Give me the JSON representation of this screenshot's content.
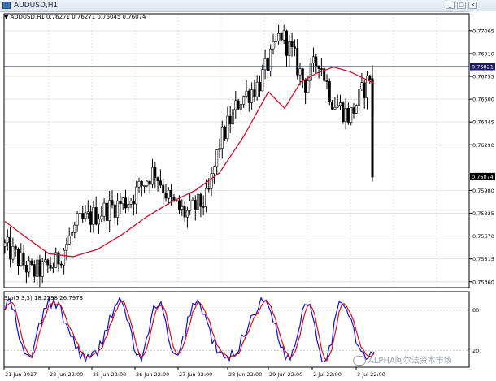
{
  "window": {
    "title": "AUDUSD,H1",
    "controls": {
      "minimize": "_",
      "restore": "□",
      "close": "×"
    }
  },
  "chart": {
    "info": "▼ AUDUSD,H1  0.76271  0.76271  0.76045  0.76074",
    "ylim": [
      0.7532,
      0.7718
    ],
    "price_labels": [
      "0.77065",
      "0.76910",
      "0.76755",
      "0.76600",
      "0.76445",
      "0.76290",
      "0.75980",
      "0.75825",
      "0.75670",
      "0.75515",
      "0.75360"
    ],
    "price_values": [
      0.77065,
      0.7691,
      0.76755,
      0.766,
      0.76445,
      0.7629,
      0.7598,
      0.75825,
      0.7567,
      0.75515,
      0.7536
    ],
    "hline": {
      "label": "0.76821",
      "value": 0.76821,
      "color": "#1a1a6e"
    },
    "current_price": {
      "label": "0.76074",
      "value": 0.76074
    },
    "ma_color": "#c8102e",
    "candle_color": "#000000"
  },
  "oscillator": {
    "info": "Sto(5,3,3) 18.2598 26.7973",
    "levels": [
      "80",
      "20"
    ],
    "level_values": [
      80,
      20
    ],
    "main_color": "#1010c8",
    "signal_color": "#d01020"
  },
  "time_axis": {
    "labels": [
      "21 Jun 2017",
      "22 Jun 22:00",
      "25 Jun 22:00",
      "26 Jun 22:00",
      "27 Jun 22:00",
      "28 Jun 22:00",
      "29 Jun 22:00",
      "2 Jul 22:00",
      "3 Jul 22:00"
    ]
  },
  "watermark": {
    "text": "ALPHA阿尔法资本市场"
  }
}
